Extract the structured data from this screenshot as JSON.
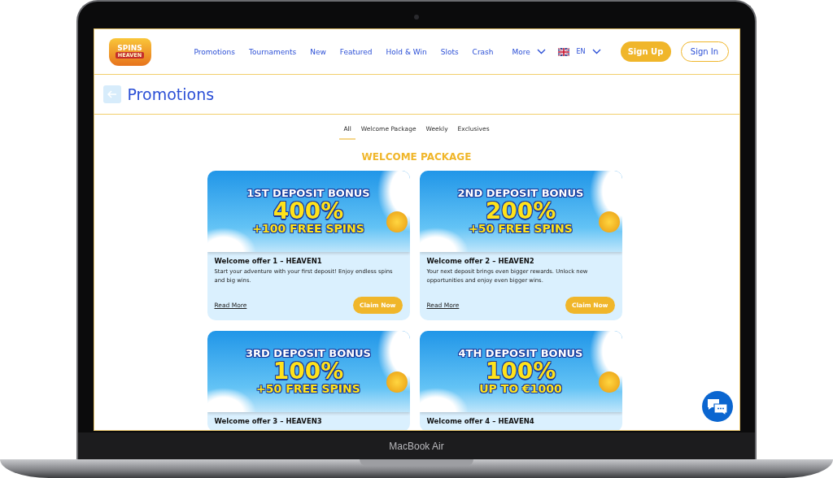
{
  "logo": {
    "line_1": "SPINS",
    "line_2": "HEAVEN"
  },
  "nav": [
    {
      "label": "Promotions"
    },
    {
      "label": "Tournaments"
    },
    {
      "label": "New"
    },
    {
      "label": "Featured"
    },
    {
      "label": "Hold & Win"
    },
    {
      "label": "Slots"
    },
    {
      "label": "Crash"
    },
    {
      "label": "More",
      "kind": "dropdown"
    }
  ],
  "language": {
    "code": "EN"
  },
  "buttons": {
    "sign_up": "Sign Up",
    "sign_in": "Sign In"
  },
  "page_title": "Promotions",
  "tabs": [
    {
      "label": "All",
      "selected": true
    },
    {
      "label": "Welcome Package",
      "selected": false
    },
    {
      "label": "Weekly",
      "selected": false
    },
    {
      "label": "Exclusives",
      "selected": false
    }
  ],
  "section_heading": "WELCOME PACKAGE",
  "cards": [
    {
      "banner": {
        "heading": "1ST DEPOSIT BONUS",
        "amount": "400%",
        "extra": "+100 FREE SPINS"
      },
      "title": "Welcome offer 1 – HEAVEN1",
      "description": "Start your adventure with your first deposit! Enjoy endless spins and big wins.",
      "link": "Read More",
      "button": "Claim Now"
    },
    {
      "banner": {
        "heading": "2ND DEPOSIT BONUS",
        "amount": "200%",
        "extra": "+50 FREE SPINS"
      },
      "title": "Welcome offer 2 – HEAVEN2",
      "description": "Your next deposit brings even bigger rewards. Unlock new opportunities and enjoy even bigger wins.",
      "link": "Read More",
      "button": "Claim Now"
    },
    {
      "banner": {
        "heading": "3RD DEPOSIT BONUS",
        "amount": "100%",
        "extra": "+50 FREE SPINS"
      },
      "title": "Welcome offer 3 – HEAVEN3"
    },
    {
      "banner": {
        "heading": "4TH DEPOSIT BONUS",
        "amount": "100%",
        "extra": "UP TO €1000"
      },
      "title": "Welcome offer 4 – HEAVEN4"
    }
  ],
  "device_label": "MacBook Air"
}
